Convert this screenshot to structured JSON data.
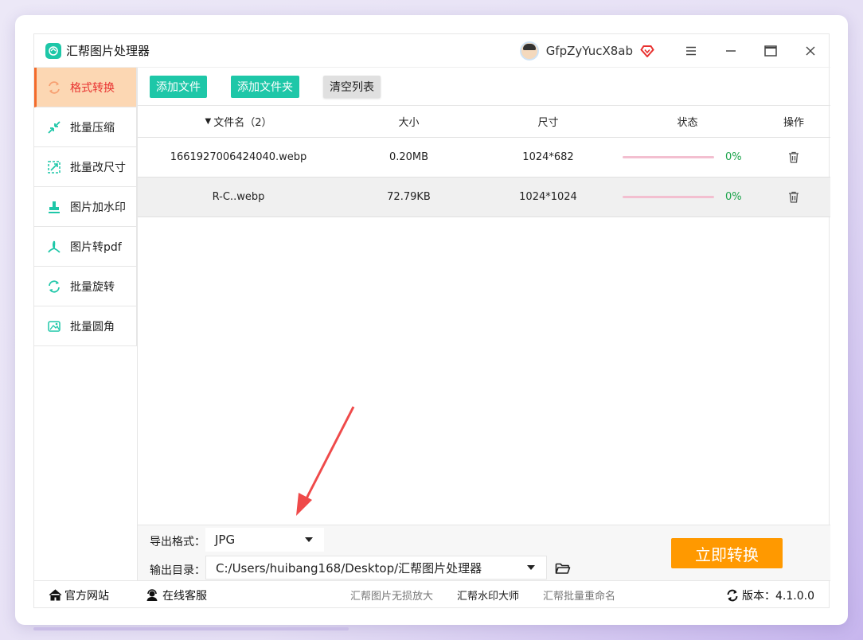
{
  "app": {
    "title": "汇帮图片处理器",
    "username": "GfpZyYucX8ab"
  },
  "window_controls": {
    "menu": "≡",
    "minimize": "—",
    "maximize": "☐",
    "close": "✕"
  },
  "sidebar": {
    "items": [
      {
        "label": "格式转换",
        "icon": "convert-icon",
        "active": true
      },
      {
        "label": "批量压缩",
        "icon": "compress-icon",
        "active": false
      },
      {
        "label": "批量改尺寸",
        "icon": "resize-icon",
        "active": false
      },
      {
        "label": "图片加水印",
        "icon": "watermark-icon",
        "active": false
      },
      {
        "label": "图片转pdf",
        "icon": "pdf-icon",
        "active": false
      },
      {
        "label": "批量旋转",
        "icon": "rotate-icon",
        "active": false
      },
      {
        "label": "批量圆角",
        "icon": "round-corner-icon",
        "active": false
      }
    ]
  },
  "toolbar": {
    "add_file": "添加文件",
    "add_folder": "添加文件夹",
    "clear_list": "清空列表"
  },
  "table": {
    "headers": {
      "name": "文件名（2）",
      "size": "大小",
      "dimension": "尺寸",
      "status": "状态",
      "action": "操作"
    },
    "rows": [
      {
        "name": "1661927006424040.webp",
        "size": "0.20MB",
        "dimension": "1024*682",
        "progress": 0,
        "percent": "0%"
      },
      {
        "name": "R-C..webp",
        "size": "72.79KB",
        "dimension": "1024*1024",
        "progress": 0,
        "percent": "0%"
      }
    ]
  },
  "output": {
    "format_label": "导出格式：",
    "format_value": "JPG",
    "dir_label": "输出目录：",
    "dir_value": "C:/Users/huibang168/Desktop/汇帮图片处理器",
    "convert_button": "立即转换"
  },
  "footer": {
    "website": "官方网站",
    "support": "在线客服",
    "link1": "汇帮图片无损放大",
    "link2": "汇帮水印大师",
    "link3": "汇帮批量重命名",
    "version": "版本：4.1.0.0"
  },
  "colors": {
    "accent_green": "#1ec7a8",
    "orange": "#ff9900",
    "active_bg": "#fcd7b3",
    "active_text": "#e8312f",
    "arrow_red": "#ef4a4a"
  }
}
